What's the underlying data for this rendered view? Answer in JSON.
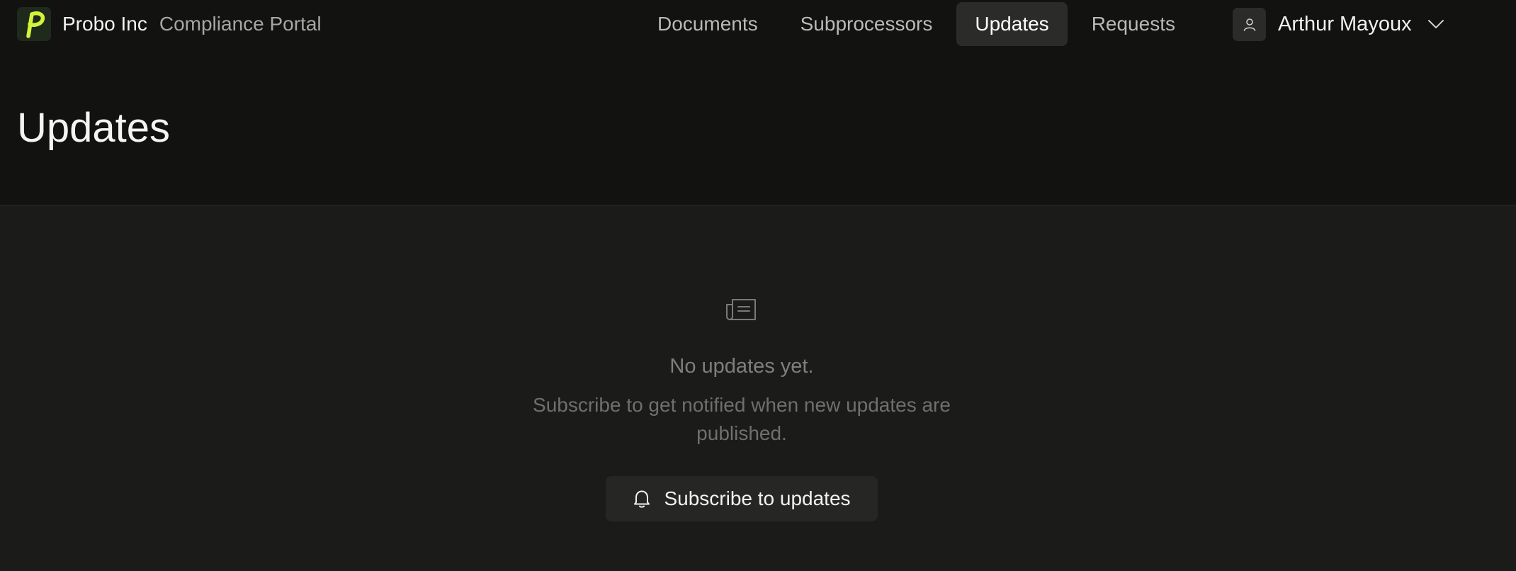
{
  "header": {
    "org_name": "Probo Inc",
    "portal_name": "Compliance Portal",
    "logo_icon": "probo-logo-icon",
    "accent_color": "#d4f33a"
  },
  "nav": {
    "items": [
      {
        "label": "Documents",
        "active": false
      },
      {
        "label": "Subprocessors",
        "active": false
      },
      {
        "label": "Updates",
        "active": true
      },
      {
        "label": "Requests",
        "active": false
      }
    ]
  },
  "user": {
    "name": "Arthur Mayoux",
    "avatar_icon": "user-icon",
    "menu_icon": "chevron-down-icon"
  },
  "page": {
    "title": "Updates"
  },
  "empty_state": {
    "icon": "newspaper-icon",
    "title": "No updates yet.",
    "description": "Subscribe to get notified when new updates are published.",
    "button_label": "Subscribe to updates",
    "button_icon": "bell-icon"
  }
}
